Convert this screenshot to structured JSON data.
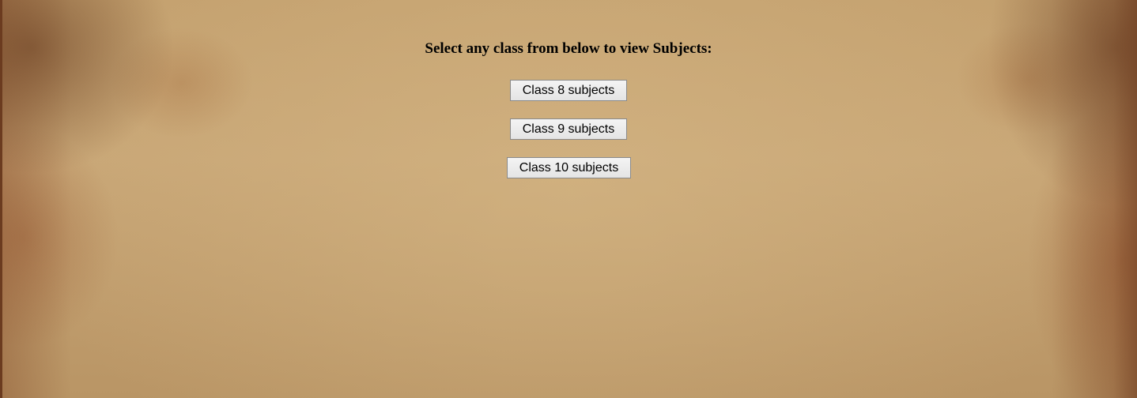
{
  "heading": "Select any class from below to view Subjects:",
  "buttons": {
    "class8": "Class 8 subjects",
    "class9": "Class 9 subjects",
    "class10": "Class 10 subjects"
  }
}
